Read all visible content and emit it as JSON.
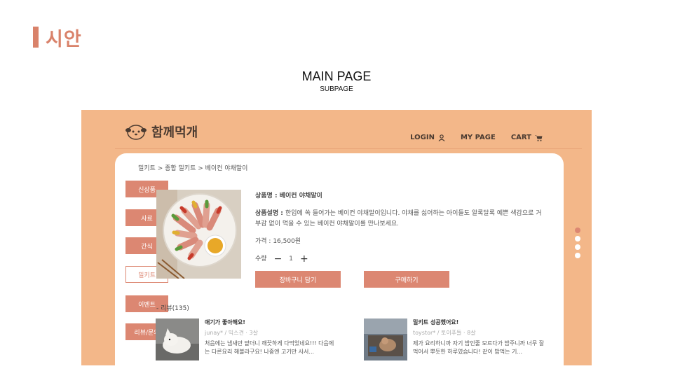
{
  "slide": {
    "title": "시안"
  },
  "page": {
    "main_title": "MAIN PAGE",
    "sub_title": "SUBPAGE"
  },
  "site": {
    "logo_text": "함께먹개",
    "nav": [
      {
        "label": "LOGIN",
        "icon": "user-icon"
      },
      {
        "label": "MY PAGE",
        "icon": ""
      },
      {
        "label": "CART",
        "icon": "cart-icon"
      }
    ]
  },
  "breadcrumb": "밀키트 > 종합 밀키트 > 베이컨 야채말이",
  "side_menu": [
    {
      "label": "신상품",
      "active": false
    },
    {
      "label": "사료",
      "active": false
    },
    {
      "label": "간식",
      "active": false
    },
    {
      "label": "밀키트",
      "active": true
    },
    {
      "label": "이벤트",
      "active": false
    },
    {
      "label": "리뷰/문의",
      "active": false
    }
  ],
  "product": {
    "name_key": "상품명 : ",
    "name_value": "베이컨 야채말이",
    "desc_key": "상품설명 : ",
    "desc_value": "한입에 쏙 들어가는 베이컨 야채말이입니다. 야채를 싫어하는 아이들도 알록달록 예쁜 색감으로 거부감 없이 먹을 수 있는 베이컨 야채말이를 만나보세요.",
    "price": "가격 : 16,500원",
    "qty_label": "수량",
    "qty_minus": "−",
    "qty_value": "1",
    "qty_plus": "+",
    "add_to_cart": "장바구니 담기",
    "buy_now": "구매하기"
  },
  "reviews": {
    "title": "- 리뷰(135)",
    "items": [
      {
        "headline": "애기가 좋아해요!",
        "meta": "junay* / 믹스견 · 3살",
        "text": "처음에는 냄새만 맡더니 깨끗하게 다먹었네요!!! 다음에는 다른요리 해볼라구요! 나중엔 고기만 사서..."
      },
      {
        "headline": "밀키트 성공했어요!",
        "meta": "toystor* / 토이푸들 · 8살",
        "text": "제가 요리하니까 자기 밥인줄 모르다가 밥주니까 너무 잘먹어서 뿌듯한 하루였습니다! 같이 밥먹는 기..."
      }
    ]
  },
  "colors": {
    "accent": "#d9826a",
    "background": "#f3b789"
  }
}
